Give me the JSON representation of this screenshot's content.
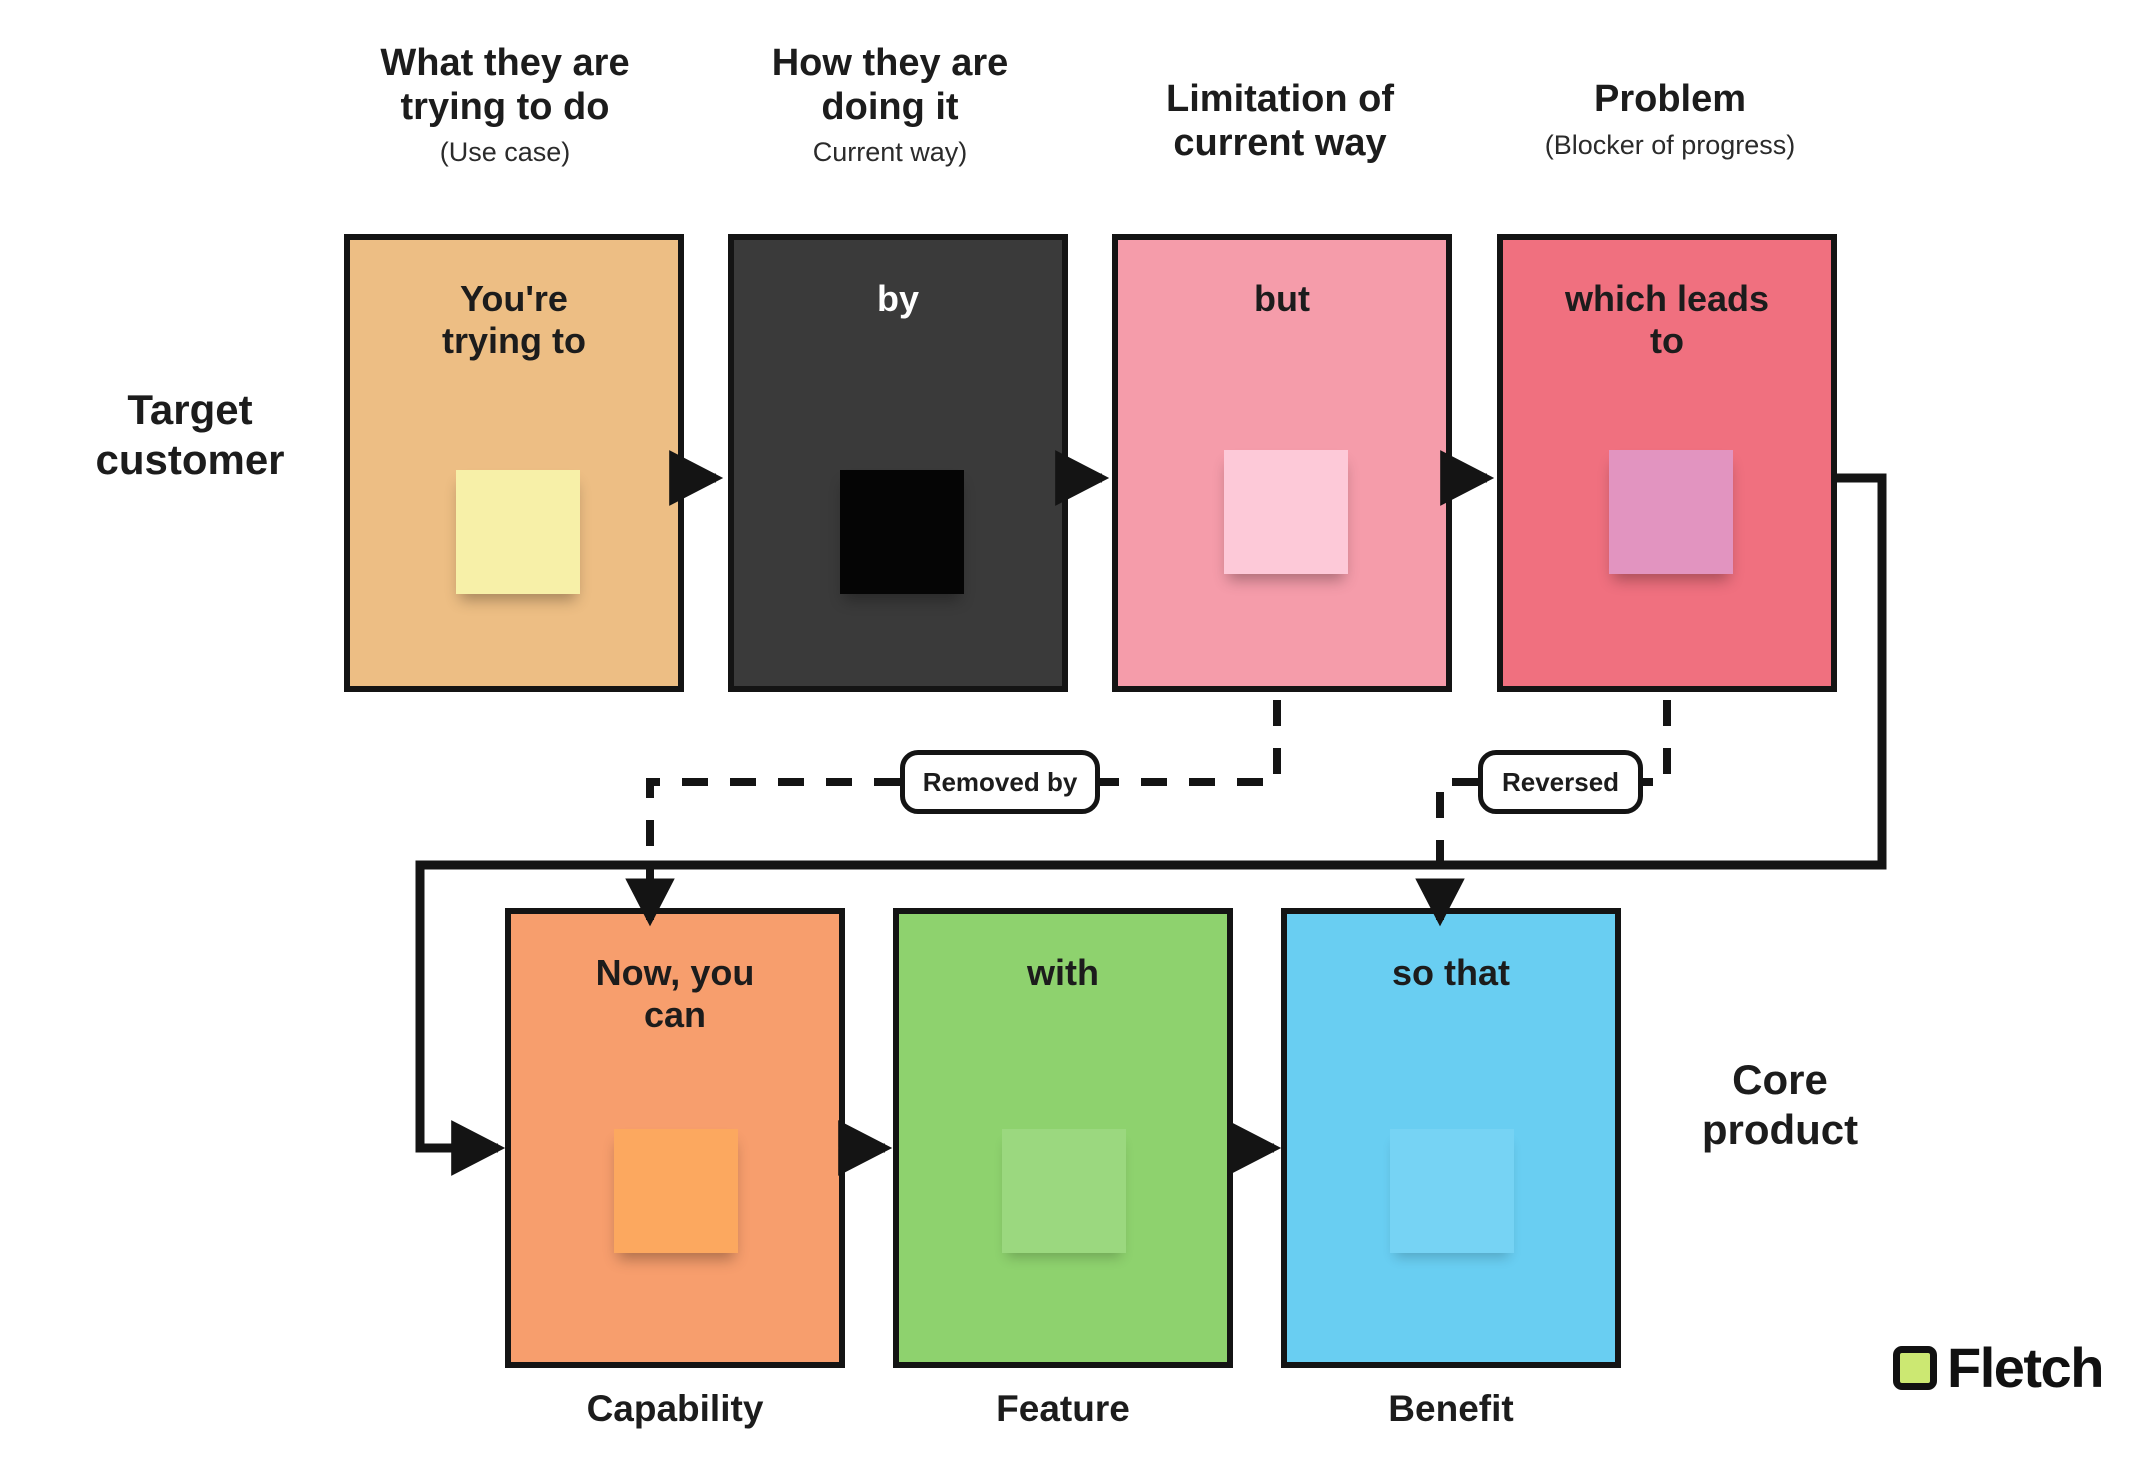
{
  "colors": {
    "use_case": "#edbe84",
    "current_way": "#3a3a3a",
    "limitation": "#f59caa",
    "problem": "#f0707f",
    "capability": "#f79e6d",
    "feature": "#8ed26e",
    "benefit": "#69cef2",
    "stroke": "#141414",
    "background": "#ffffff",
    "logo_mark": "#cce872"
  },
  "headers": [
    {
      "title": "What they are\ntrying to do",
      "sub": "(Use case)"
    },
    {
      "title": "How they are\ndoing it",
      "sub": "Current way)"
    },
    {
      "title": "Limitation of\ncurrent way",
      "sub": ""
    },
    {
      "title": "Problem",
      "sub": "(Blocker of progress)"
    }
  ],
  "side_labels": {
    "target_customer": "Target\ncustomer",
    "core_product": "Core\nproduct"
  },
  "top_cards": [
    {
      "label": "You're\ntrying to",
      "fill": "#edbe84",
      "text_color": "#1c1c1c",
      "sticky": "#f7f0a8"
    },
    {
      "label": "by",
      "fill": "#3a3a3a",
      "text_color": "#ffffff",
      "sticky": "#050505"
    },
    {
      "label": "but",
      "fill": "#f59caa",
      "text_color": "#1c1c1c",
      "sticky": "#fdc9d8"
    },
    {
      "label": "which leads\nto",
      "fill": "#f0707f",
      "text_color": "#1c1c1c",
      "sticky": "#e294c0"
    }
  ],
  "bottom_cards": [
    {
      "label": "Now, you\ncan",
      "fill": "#f79e6d",
      "text_color": "#1c1c1c",
      "sticky": "#fca košice"
    },
    {
      "label": "with",
      "fill": "#8ed26e",
      "text_color": "#1c1c1c",
      "sticky": "#a3dd88"
    },
    {
      "label": "so that",
      "fill": "#69cef2",
      "text_color": "#1c1c1c",
      "sticky": "#7dd6f5"
    }
  ],
  "bottom_captions": [
    "Capability",
    "Feature",
    "Benefit"
  ],
  "connector_labels": {
    "removed_by": "Removed by",
    "reversed": "Reversed"
  },
  "logo": {
    "word": "Fletch",
    "mark_name": "fletch-square-icon"
  }
}
